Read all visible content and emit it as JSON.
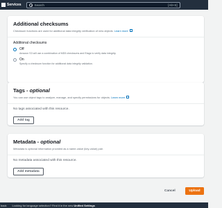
{
  "topnav": {
    "services_label": "Services",
    "search_placeholder": "Search",
    "search_shortcut": "[Alt+S]"
  },
  "checksums": {
    "title": "Additional checksums",
    "description": "Checksum functions are used for additional data integrity verification of new objects.",
    "learn_more": "Learn more",
    "field_label": "Additional checksums",
    "options": [
      {
        "label": "Off",
        "description": "Amazon S3 will use a combination of MD5 checksums and Etags to verify data integrity.",
        "checked": true
      },
      {
        "label": "On",
        "description": "Specify a checksum function for additional data integrity validation.",
        "checked": false
      }
    ]
  },
  "tags": {
    "title": "Tags - ",
    "title_suffix": "optional",
    "description": "You can use object tags to analyze, manage, and specify permissions for objects.",
    "learn_more": "Learn more",
    "empty_text": "No tags associated with this resource.",
    "add_button": "Add tag"
  },
  "metadata": {
    "title": "Metadata - ",
    "title_suffix": "optional",
    "description": "Metadata is optional information provided as a name-value (key-value) pair.",
    "learn_more": "Learn more",
    "empty_text": "No metadata associated with this resource.",
    "add_button": "Add metadata"
  },
  "actions": {
    "cancel": "Cancel",
    "upload": "Upload"
  },
  "bottombar": {
    "left_text": "back",
    "message": "Looking for language selection? Find it in the new",
    "link": "Unified Settings"
  },
  "colors": {
    "nav_bg": "#232f3e",
    "primary": "#ec7211",
    "link": "#0073bb"
  }
}
